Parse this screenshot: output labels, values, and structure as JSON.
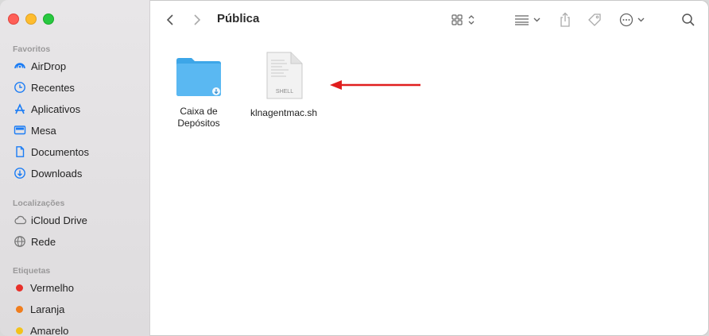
{
  "window": {
    "title": "Pública"
  },
  "sidebar": {
    "sections": [
      {
        "title": "Favoritos",
        "items": [
          {
            "label": "AirDrop",
            "icon": "airdrop-icon"
          },
          {
            "label": "Recentes",
            "icon": "clock-icon"
          },
          {
            "label": "Aplicativos",
            "icon": "applications-icon"
          },
          {
            "label": "Mesa",
            "icon": "desktop-icon"
          },
          {
            "label": "Documentos",
            "icon": "document-icon"
          },
          {
            "label": "Downloads",
            "icon": "download-icon"
          }
        ]
      },
      {
        "title": "Localizações",
        "items": [
          {
            "label": "iCloud Drive",
            "icon": "cloud-icon"
          },
          {
            "label": "Rede",
            "icon": "network-icon"
          }
        ]
      },
      {
        "title": "Etiquetas",
        "items": [
          {
            "label": "Vermelho",
            "color": "#e8302a"
          },
          {
            "label": "Laranja",
            "color": "#f07d1d"
          },
          {
            "label": "Amarelo",
            "color": "#f3c21b"
          }
        ]
      }
    ]
  },
  "files": [
    {
      "name": "Caixa de Depósitos",
      "line1": "Caixa de",
      "line2": "Depósitos",
      "icon": "folder-download-icon"
    },
    {
      "name": "klnagentmac.sh",
      "icon": "shell-script-icon",
      "badge": "SHELL"
    }
  ],
  "colors": {
    "accent": "#1a7cf5",
    "arrow": "#e01e1e",
    "folder": "#52b4ef"
  }
}
